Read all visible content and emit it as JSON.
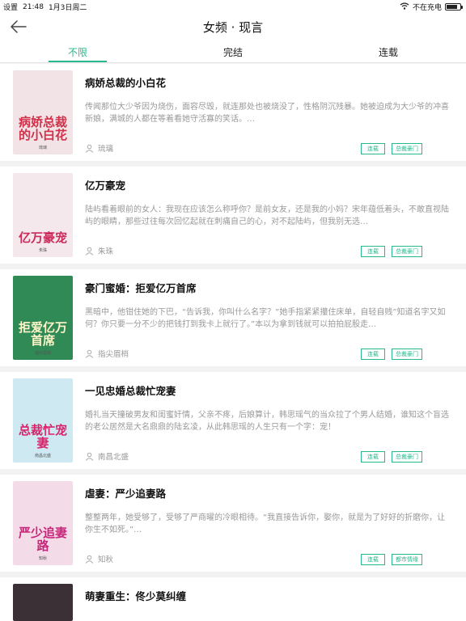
{
  "status_bar": {
    "settings": "设置",
    "time": "21:48",
    "date": "1月3日周二",
    "charging": "不在充电",
    "battery_level": 0.8
  },
  "nav": {
    "title": "女频 · 现言"
  },
  "tabs": [
    {
      "label": "不限",
      "active": true
    },
    {
      "label": "完结",
      "active": false
    },
    {
      "label": "连载",
      "active": false
    }
  ],
  "books": [
    {
      "title": "病娇总裁的小白花",
      "desc": "传闻那位大少爷因为烧伤，面容尽毁，就连那处也被烧没了，性格阴沉残暴。她被迫成为大少爷的冲喜新娘，满城的人都在等着看她守活寡的笑话。…",
      "author": "琉璃",
      "tags": [
        "连载",
        "总裁豪门"
      ],
      "cover": {
        "title": "病娇总裁的小白花",
        "author": "琉璃",
        "bg": "#f2e4e6",
        "color": "#d2304a"
      }
    },
    {
      "title": "亿万豪宠",
      "desc": "陆屿看着眼前的女人：我现在应该怎么称呼你？是前女友，还是我的小妈？宋年蕴低着头，不敢直视陆屿的眼睛，那些过往每次回忆起就在刺痛自己的心，对不起陆屿，但我别无选…",
      "author": "朱珠",
      "tags": [
        "连载",
        "总裁豪门"
      ],
      "cover": {
        "title": "亿万豪宠",
        "author": "朱珠",
        "bg": "#f4e8ec",
        "color": "#cc2a5a"
      }
    },
    {
      "title": "豪门蜜婚：拒爱亿万首席",
      "desc": "黑暗中，他钳住她的下巴，“告诉我，你叫什么名字？”她手指紧紧攥住床单，自轻自贱”知道名字又如何？你只要一分不少的把钱打到我卡上就行了。”本以为拿到钱就可以拍拍屁股走…",
      "author": "指尖眉梢",
      "tags": [
        "连载",
        "总裁豪门"
      ],
      "cover": {
        "title": "拒爱亿万首席",
        "author": "指尖眉梢",
        "bg": "#2f8a56",
        "color": "#fff5c8"
      }
    },
    {
      "title": "一见忠婚总裁忙宠妻",
      "desc": "婚礼当天撞破男友和闺蜜奸情，父亲不疼，后娘算计，韩思瑶气的当众拉了个男人结婚，谁知这个盲选的老公居然是大名鼎鼎的陆玄凌，从此韩思瑶的人生只有一个字：宠！",
      "author": "南昌北盛",
      "tags": [
        "连载",
        "总裁豪门"
      ],
      "cover": {
        "title": "总裁忙宠妻",
        "author": "南昌北盛",
        "bg": "#cfe9f3",
        "color": "#d8236a"
      }
    },
    {
      "title": "虐妻：严少追妻路",
      "desc": "整整两年，她受够了，受够了严商曜的冷眼相待。“我直接告诉你，娶你，就是为了好好的折磨你，让你生不如死。”…",
      "author": "知秋",
      "tags": [
        "连载",
        "都市情缘"
      ],
      "cover": {
        "title": "严少追妻路",
        "author": "知秋",
        "bg": "#f3dbe8",
        "color": "#c8267a"
      }
    },
    {
      "title": "萌妻重生：佟少莫纠缠",
      "desc": "",
      "author": "",
      "tags": [],
      "cover": {
        "title": "",
        "author": "",
        "bg": "#3a3036",
        "color": "#ffffff"
      }
    }
  ],
  "icons": {
    "back": "arrow-left-icon",
    "wifi": "wifi-icon",
    "battery": "battery-icon",
    "author": "person-icon"
  },
  "colors": {
    "accent": "#27b88e",
    "muted": "#999999"
  }
}
